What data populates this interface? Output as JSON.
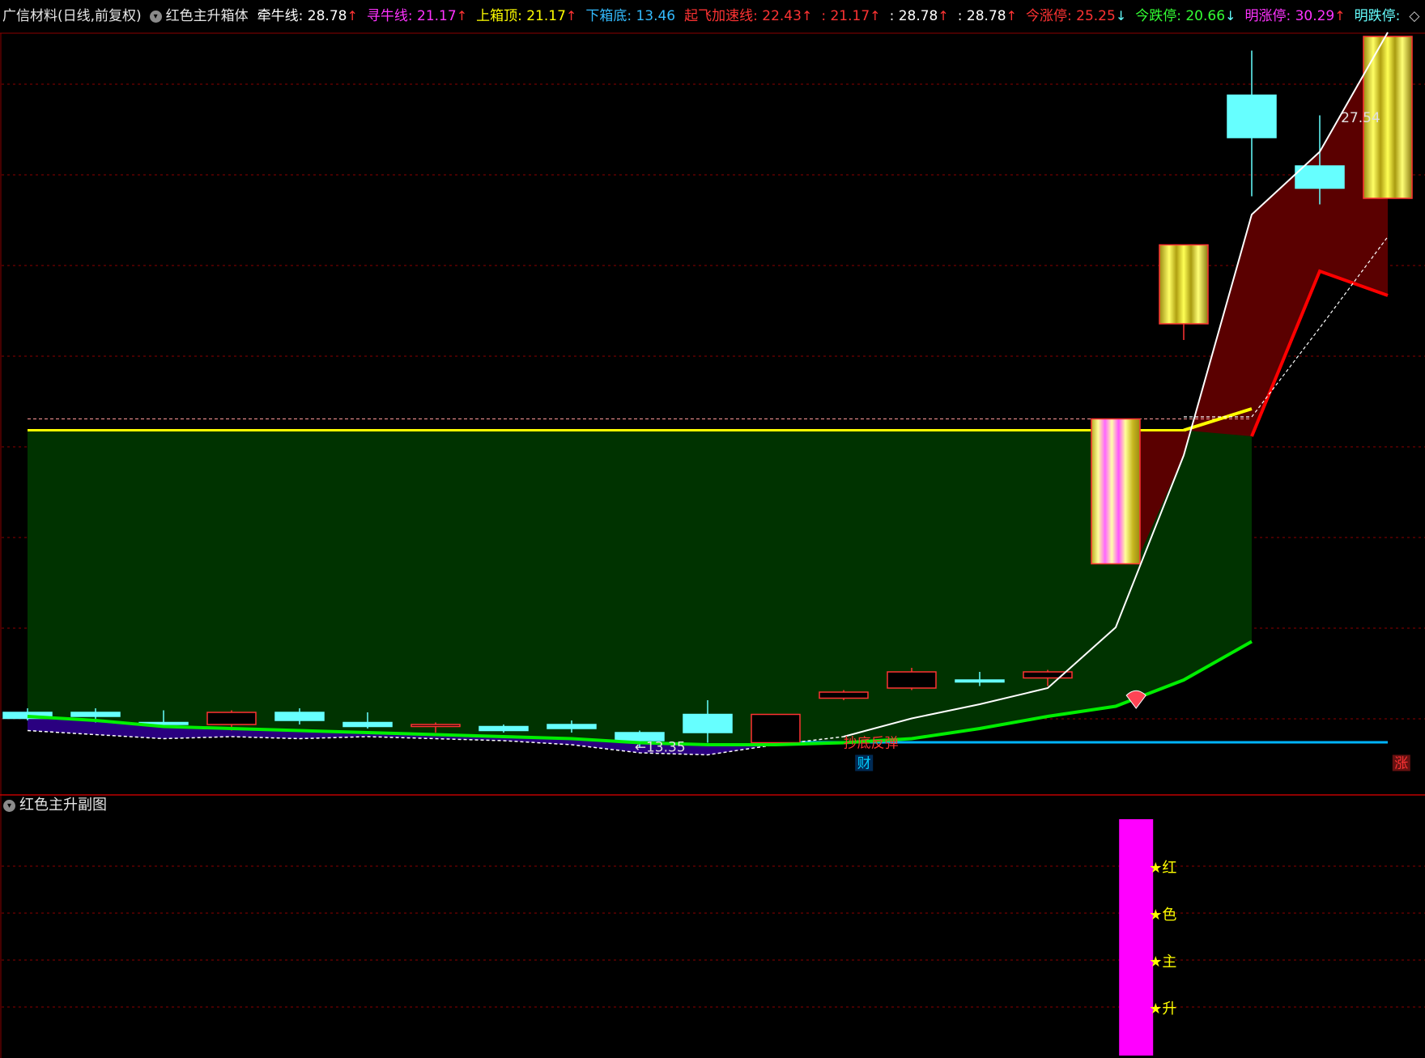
{
  "header": {
    "stock_name": "广信材料(日线,前复权)",
    "indicator_name": "红色主升箱体",
    "items": [
      {
        "label": "牵牛线",
        "value": "28.78",
        "dir": "up",
        "color": "#ffffff"
      },
      {
        "label": "寻牛线",
        "value": "21.17",
        "dir": "up",
        "color": "#ff33ff"
      },
      {
        "label": "上箱顶",
        "value": "21.17",
        "dir": "up",
        "color": "#ffff00"
      },
      {
        "label": "下箱底",
        "value": "13.46",
        "dir": "",
        "color": "#33bbff"
      },
      {
        "label": "起飞加速线",
        "value": "22.43",
        "dir": "up",
        "color": "#ff3333"
      },
      {
        "label": "",
        "value": "21.17",
        "dir": "up",
        "color": "#ff3333"
      },
      {
        "label": "",
        "value": "28.78",
        "dir": "up",
        "color": "#ffffff"
      },
      {
        "label": "",
        "value": "28.78",
        "dir": "up",
        "color": "#ffffff"
      },
      {
        "label": "今涨停",
        "value": "25.25",
        "dir": "down",
        "color": "#ff3333"
      },
      {
        "label": "今跌停",
        "value": "20.66",
        "dir": "down",
        "color": "#33ff33"
      },
      {
        "label": "明涨停",
        "value": "30.29",
        "dir": "up",
        "color": "#ff33ff"
      },
      {
        "label": "明跌停",
        "value": "",
        "dir": "",
        "color": "#66ffff"
      }
    ],
    "more_icon": "diamond-icon"
  },
  "sub_header": {
    "title": "红色主升副图"
  },
  "colors": {
    "up_candle": "#ff3333",
    "down_candle": "#66ffff",
    "box_fill": "#003300",
    "box_top": "#ffff00",
    "support_line": "#00ee00",
    "bottom_line": "#00b4ff",
    "ascend_fill": "#5a0000",
    "ascend_edge": "#ff0000",
    "low_fill": "#2a0080",
    "gridline": "#8b0000",
    "sub_bar": "#ff00ff",
    "sub_star": "#ffff00"
  },
  "chart_data": {
    "type": "candlestick",
    "price_range": [
      12.4,
      31.0
    ],
    "upper_box_level": 21.17,
    "lower_box_level": 13.46,
    "dashed_level": 21.45,
    "candles": [
      {
        "o": 14.2,
        "h": 14.3,
        "l": 14.0,
        "c": 14.05
      },
      {
        "o": 14.2,
        "h": 14.3,
        "l": 13.95,
        "c": 14.1
      },
      {
        "o": 13.95,
        "h": 14.25,
        "l": 13.85,
        "c": 13.9
      },
      {
        "o": 13.9,
        "h": 14.25,
        "l": 13.75,
        "c": 14.2
      },
      {
        "o": 14.2,
        "h": 14.3,
        "l": 13.9,
        "c": 14.0
      },
      {
        "o": 13.95,
        "h": 14.2,
        "l": 13.8,
        "c": 13.85
      },
      {
        "o": 13.85,
        "h": 13.95,
        "l": 13.7,
        "c": 13.9
      },
      {
        "o": 13.85,
        "h": 13.9,
        "l": 13.7,
        "c": 13.75
      },
      {
        "o": 13.9,
        "h": 14.0,
        "l": 13.7,
        "c": 13.8
      },
      {
        "o": 13.7,
        "h": 13.75,
        "l": 13.35,
        "c": 13.5
      },
      {
        "o": 14.15,
        "h": 14.5,
        "l": 13.45,
        "c": 13.7
      },
      {
        "o": 13.45,
        "h": 14.15,
        "l": 13.45,
        "c": 14.15
      },
      {
        "o": 14.55,
        "h": 14.75,
        "l": 14.5,
        "c": 14.7
      },
      {
        "o": 14.8,
        "h": 15.3,
        "l": 14.75,
        "c": 15.2
      },
      {
        "o": 15.0,
        "h": 15.2,
        "l": 14.85,
        "c": 14.95
      },
      {
        "o": 15.05,
        "h": 15.25,
        "l": 14.85,
        "c": 15.2
      },
      {
        "o": 17.87,
        "h": 21.45,
        "l": 17.87,
        "c": 21.45
      },
      {
        "o": 23.8,
        "h": 25.75,
        "l": 23.4,
        "c": 25.75
      },
      {
        "o": 29.45,
        "h": 30.55,
        "l": 26.95,
        "c": 28.4
      },
      {
        "o": 27.7,
        "h": 28.95,
        "l": 26.75,
        "c": 27.15
      },
      {
        "o": 30.9,
        "h": 30.9,
        "l": 26.9,
        "c": 26.9
      }
    ],
    "white_line": [
      null,
      null,
      null,
      null,
      null,
      null,
      null,
      null,
      null,
      null,
      null,
      null,
      13.6,
      14.05,
      14.4,
      14.8,
      16.3,
      20.55,
      26.5,
      28.05,
      31.0
    ],
    "support_line": [
      14.1,
      14.0,
      13.85,
      13.8,
      13.75,
      13.7,
      13.65,
      13.6,
      13.55,
      13.45,
      13.4,
      13.4,
      13.45,
      13.55,
      13.8,
      14.1,
      14.35,
      15.0,
      15.95,
      null,
      null
    ],
    "dashed_white": [
      13.75,
      13.65,
      13.55,
      13.6,
      13.55,
      13.6,
      13.55,
      13.5,
      13.4,
      13.2,
      13.15,
      13.4,
      13.6,
      null,
      null,
      null,
      null,
      21.5,
      21.5,
      23.7,
      25.95
    ],
    "ascend_edge": [
      null,
      null,
      null,
      null,
      null,
      null,
      null,
      null,
      null,
      null,
      null,
      null,
      null,
      null,
      null,
      null,
      null,
      null,
      21.02,
      25.1,
      24.5
    ],
    "ascend_yellow": [
      null,
      null,
      null,
      null,
      null,
      null,
      null,
      null,
      null,
      null,
      null,
      null,
      null,
      null,
      null,
      null,
      null,
      21.17,
      21.7,
      null,
      null
    ],
    "labels": [
      {
        "text": "27.54",
        "color": "#e0e0e0",
        "candle": 19.6,
        "price": 28.9
      },
      {
        "text": "←13.35",
        "color": "#e0e0e0",
        "candle": 9.3,
        "price": 13.35
      },
      {
        "text": "抄底反弹",
        "color": "#ff3333",
        "candle": 12.4,
        "price": 13.45
      },
      {
        "text": "财",
        "color": "#00ccff",
        "candle": 12.3,
        "price": 12.95
      },
      {
        "text": "涨",
        "color": "#ff3333",
        "candle": 20.2,
        "price": 12.95
      }
    ],
    "sub_chart": {
      "bar_candle": 16.3,
      "stars": [
        "★红",
        "★色",
        "★主",
        "★升"
      ]
    }
  }
}
